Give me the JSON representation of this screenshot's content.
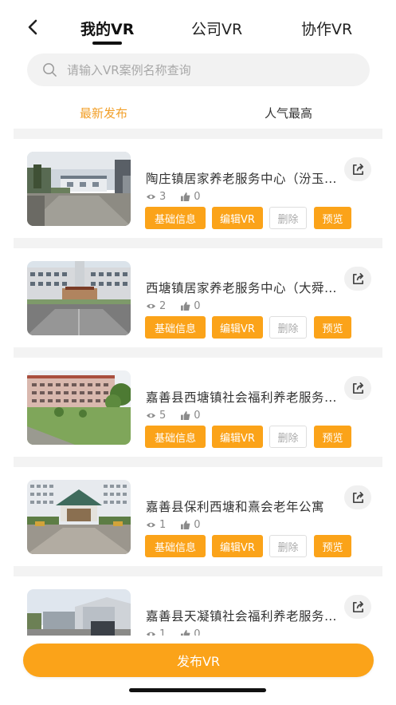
{
  "header": {
    "tabs": [
      {
        "label": "我的VR",
        "active": true
      },
      {
        "label": "公司VR",
        "active": false
      },
      {
        "label": "协作VR",
        "active": false
      }
    ]
  },
  "search": {
    "placeholder": "请输入VR案例名称查询",
    "value": ""
  },
  "sort_tabs": [
    {
      "label": "最新发布",
      "active": true
    },
    {
      "label": "人气最高",
      "active": false
    }
  ],
  "actions": {
    "info": "基础信息",
    "edit": "编辑VR",
    "delete": "删除",
    "preview": "预览"
  },
  "items": [
    {
      "title": "陶庄镇居家养老服务中心（汾玉村）",
      "views": "3",
      "likes": "0"
    },
    {
      "title": "西塘镇居家养老服务中心（大舜村）",
      "views": "2",
      "likes": "0"
    },
    {
      "title": "嘉善县西塘镇社会福利养老服务中心",
      "views": "5",
      "likes": "0"
    },
    {
      "title": "嘉善县保利西塘和熹会老年公寓",
      "views": "1",
      "likes": "0"
    },
    {
      "title": "嘉善县天凝镇社会福利养老服务中心",
      "views": "1",
      "likes": "0"
    }
  ],
  "bottom": {
    "publish_label": "发布VR"
  },
  "colors": {
    "accent": "#fba319",
    "active_sort": "#f2a02a",
    "divider": "#f3f3f3"
  },
  "icons": {
    "back": "chevron-left-icon",
    "search": "search-icon",
    "views": "eye-icon",
    "likes": "thumbs-up-icon",
    "share": "share-icon"
  }
}
